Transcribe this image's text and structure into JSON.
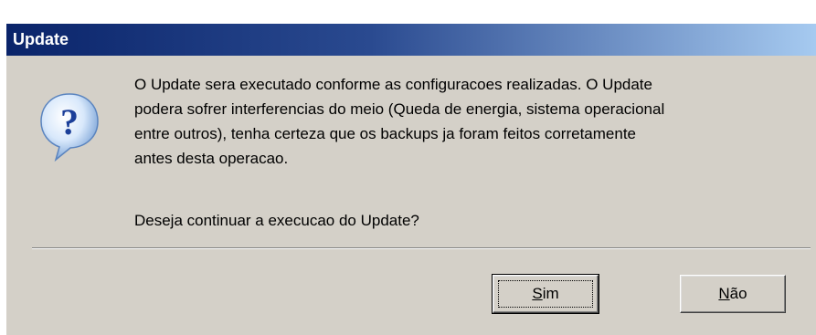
{
  "window": {
    "title": "Update"
  },
  "icon": {
    "name": "question-icon",
    "glyph": "?"
  },
  "message": {
    "lines": [
      "O Update sera executado conforme as configuracoes realizadas. O Update",
      "podera sofrer interferencias do meio (Queda de energia, sistema operacional",
      "entre outros), tenha certeza que os backups ja foram feitos corretamente",
      "antes desta operacao."
    ],
    "question": "Deseja continuar a execucao do Update?"
  },
  "buttons": {
    "yes_label": "Sim",
    "no_label": "Não"
  },
  "colors": {
    "title_gradient_start": "#0a246a",
    "title_gradient_end": "#a6caf0",
    "dialog_background": "#d4d0c8"
  }
}
